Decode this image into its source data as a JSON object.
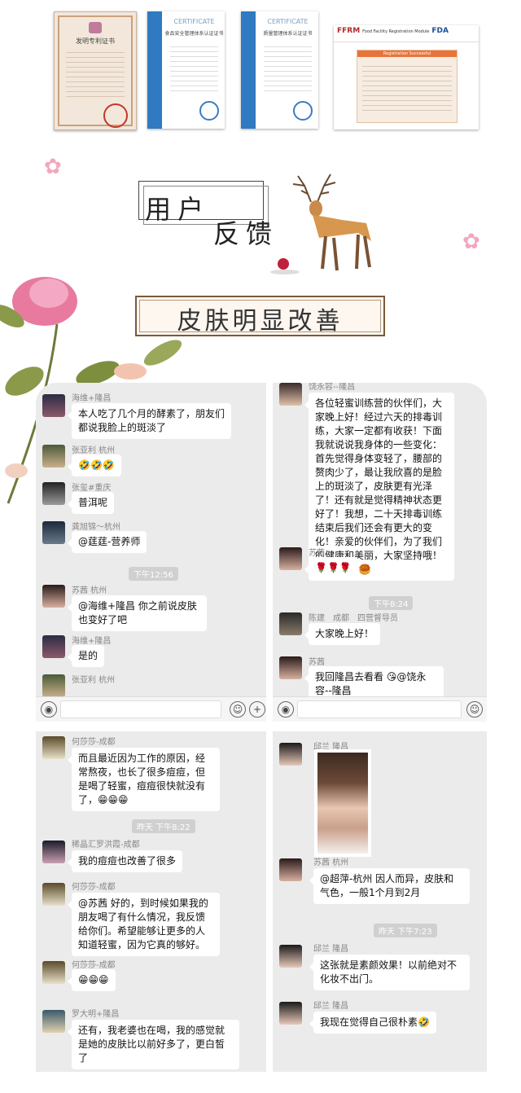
{
  "certificates": {
    "c1_title": "发明专利证书",
    "c2_head": "CERTIFICATE",
    "c2_title": "食品安全管理体系认证证书",
    "c3_head": "CERTIFICATE",
    "c3_title": "质量管理体系认证证书",
    "c4_logo": "FFRM",
    "c4_sub": "Food Facility Registration Module",
    "c4_fda": "FDA",
    "c4_bar": "Registration Successful"
  },
  "header": {
    "title_user": "用户",
    "title_feedback": "反馈",
    "banner": "皮肤明显改善"
  },
  "panel1": {
    "m1_name": "海维+隆昌",
    "m1_text": "本人吃了几个月的酵素了，朋友们都说我脸上的斑淡了",
    "m2_name": "张亚利 杭州",
    "m2_text": "🤣🤣🤣",
    "m3_name": "张玺#重庆",
    "m3_text": "普洱呢",
    "m4_name": "龚旭锦～杭州",
    "m4_text": "@莛莛-营养师",
    "time1": "下午12:56",
    "m5_name": "苏茜 杭州",
    "m5_text": "@海维+隆昌 你之前说皮肤也变好了吧",
    "m6_name": "海维+隆昌",
    "m6_text": "是的",
    "m7_name": "张亚利 杭州"
  },
  "panel2": {
    "m1_name": "饶永容--隆昌",
    "m1_text": "各位轻蜜训练营的伙伴们，大家晚上好！经过六天的排毒训练，大家一定都有收获！下面我就说说我身体的一些变化：首先觉得身体变轻了，腰部的赘肉少了，最让我欣喜的是脸上的斑淡了，皮肤更有光泽了！还有就是觉得精神状态更好了！我想，二十天排毒训练结束后我们还会有更大的变化！亲爱的伙伴们，为了我们的健康和美丽，大家坚持哦！加油🥮🥮🥮",
    "m2_name": "苏茜",
    "m2_text": "🌹🌹🌹",
    "time1": "下午8:24",
    "m3_name": "陈建　成都　四营督导员",
    "m3_text": "大家晚上好！",
    "m4_name": "苏茜",
    "m4_text": "我回隆昌去看看 😘@饶永容--隆昌"
  },
  "panel3": {
    "m1_name": "何莎莎-成都",
    "m1_text": "而且最近因为工作的原因，经常熬夜，也长了很多痘痘，但是喝了轻蜜，痘痘很快就没有了，😁😁😁",
    "time1": "昨天 下午8:22",
    "m2_name": "稀晶汇罗洪霞-成都",
    "m2_text": "我的痘痘也改善了很多",
    "m3_name": "何莎莎-成都",
    "m3_text": "@苏茜 好的，到时候如果我的朋友喝了有什么情况，我反馈给你们。希望能够让更多的人知道轻蜜，因为它真的够好。",
    "m4_name": "何莎莎-成都",
    "m4_text": "😁😁😁",
    "m5_name": "罗大明+隆昌",
    "m5_text": "还有，我老婆也在喝，我的感觉就是她的皮肤比以前好多了，更白皙了"
  },
  "panel4": {
    "m1_name": "邱兰 隆昌",
    "m2_name": "苏茜 杭州",
    "m2_text": "@超萍-杭州 因人而异，皮肤和气色，一般1个月到2月",
    "time1": "昨天 下午7:23",
    "m3_name": "邱兰 隆昌",
    "m3_text": "这张就是素颜效果！以前绝对不化妆不出门。",
    "m4_name": "邱兰 隆昌",
    "m4_text": "我现在觉得自己很朴素🤣"
  },
  "icons": {
    "voice": "voice-icon",
    "emoji": "emoji-icon",
    "plus": "plus-icon"
  }
}
